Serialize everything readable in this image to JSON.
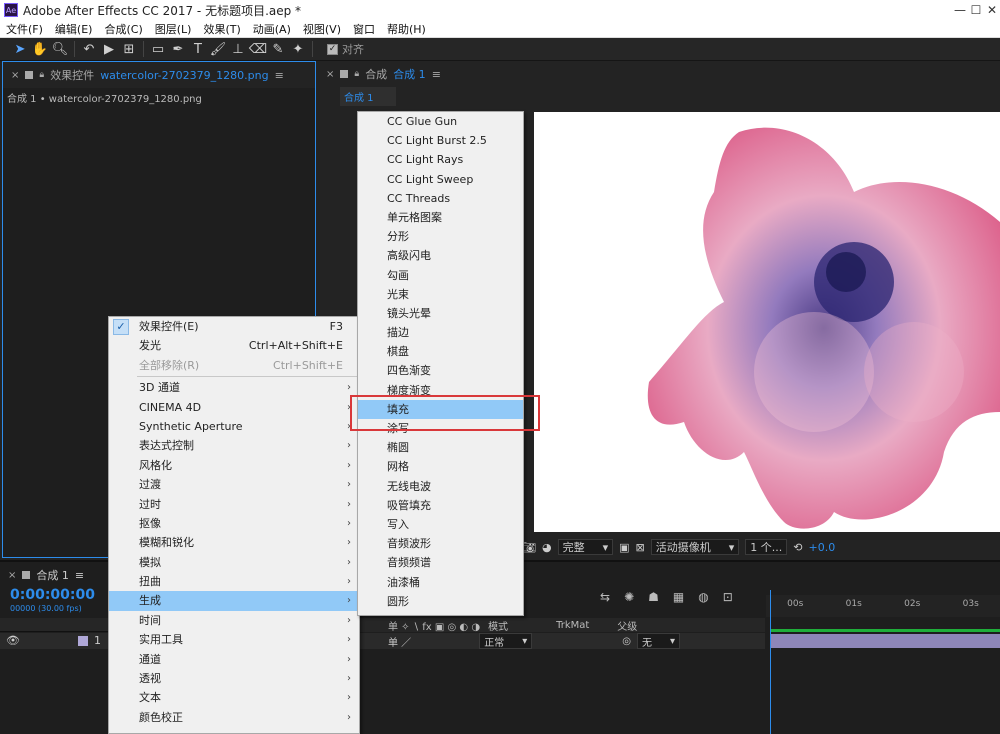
{
  "title": "Adobe After Effects CC 2017 - 无标题项目.aep *",
  "app_icon": "Ae",
  "menubar": [
    "文件(F)",
    "编辑(E)",
    "合成(C)",
    "图层(L)",
    "效果(T)",
    "动画(A)",
    "视图(V)",
    "窗口",
    "帮助(H)"
  ],
  "toolbar": {
    "snap_label": "对齐"
  },
  "effects_panel": {
    "tab_label": "效果控件",
    "tab_file": "watercolor-2702379_1280.png",
    "subtitle": "合成 1 • watercolor-2702379_1280.png"
  },
  "comp_panel": {
    "tab_label": "合成",
    "tab_name": "合成 1",
    "subtab": "合成 1"
  },
  "viewer_bar": {
    "quality": "完整",
    "camera": "活动摄像机",
    "views": "1 个...",
    "exposure": "+0.0"
  },
  "timeline": {
    "tab": "合成 1",
    "timecode": "0:00:00:00",
    "fps": "00000 (30.00 fps)",
    "cols": {
      "mode": "模式",
      "trkmat": "TrkMat",
      "parent": "父级"
    },
    "row": {
      "index": "1",
      "mode": "正常",
      "parent": "无"
    },
    "ruler": [
      "00s",
      "01s",
      "02s",
      "03s"
    ]
  },
  "context_menu": {
    "items": [
      {
        "label": "效果控件(E)",
        "shortcut": "F3",
        "checked": true
      },
      {
        "label": "发光",
        "shortcut": "Ctrl+Alt+Shift+E"
      },
      {
        "label": "全部移除(R)",
        "shortcut": "Ctrl+Shift+E",
        "disabled": true
      },
      {
        "label": "3D 通道",
        "sub": true
      },
      {
        "label": "CINEMA 4D",
        "sub": true
      },
      {
        "label": "Synthetic Aperture",
        "sub": true
      },
      {
        "label": "表达式控制",
        "sub": true
      },
      {
        "label": "风格化",
        "sub": true
      },
      {
        "label": "过渡",
        "sub": true
      },
      {
        "label": "过时",
        "sub": true
      },
      {
        "label": "抠像",
        "sub": true
      },
      {
        "label": "模糊和锐化",
        "sub": true
      },
      {
        "label": "模拟",
        "sub": true
      },
      {
        "label": "扭曲",
        "sub": true
      },
      {
        "label": "生成",
        "sub": true,
        "highlighted": true
      },
      {
        "label": "时间",
        "sub": true
      },
      {
        "label": "实用工具",
        "sub": true
      },
      {
        "label": "通道",
        "sub": true
      },
      {
        "label": "透视",
        "sub": true
      },
      {
        "label": "文本",
        "sub": true
      },
      {
        "label": "颜色校正",
        "sub": true
      }
    ]
  },
  "submenu": {
    "items": [
      "CC Glue Gun",
      "CC Light Burst 2.5",
      "CC Light Rays",
      "CC Light Sweep",
      "CC Threads",
      "单元格图案",
      "分形",
      "高级闪电",
      "勾画",
      "光束",
      "镜头光晕",
      "描边",
      "棋盘",
      "四色渐变",
      "梯度渐变",
      "填充",
      "涂写",
      "椭圆",
      "网格",
      "无线电波",
      "吸管填充",
      "写入",
      "音频波形",
      "音频频谱",
      "油漆桶",
      "圆形"
    ],
    "highlighted_index": 15
  },
  "colors": {
    "accent": "#2d8ceb",
    "highlight": "#91c9f7",
    "callout": "#d9383a"
  }
}
